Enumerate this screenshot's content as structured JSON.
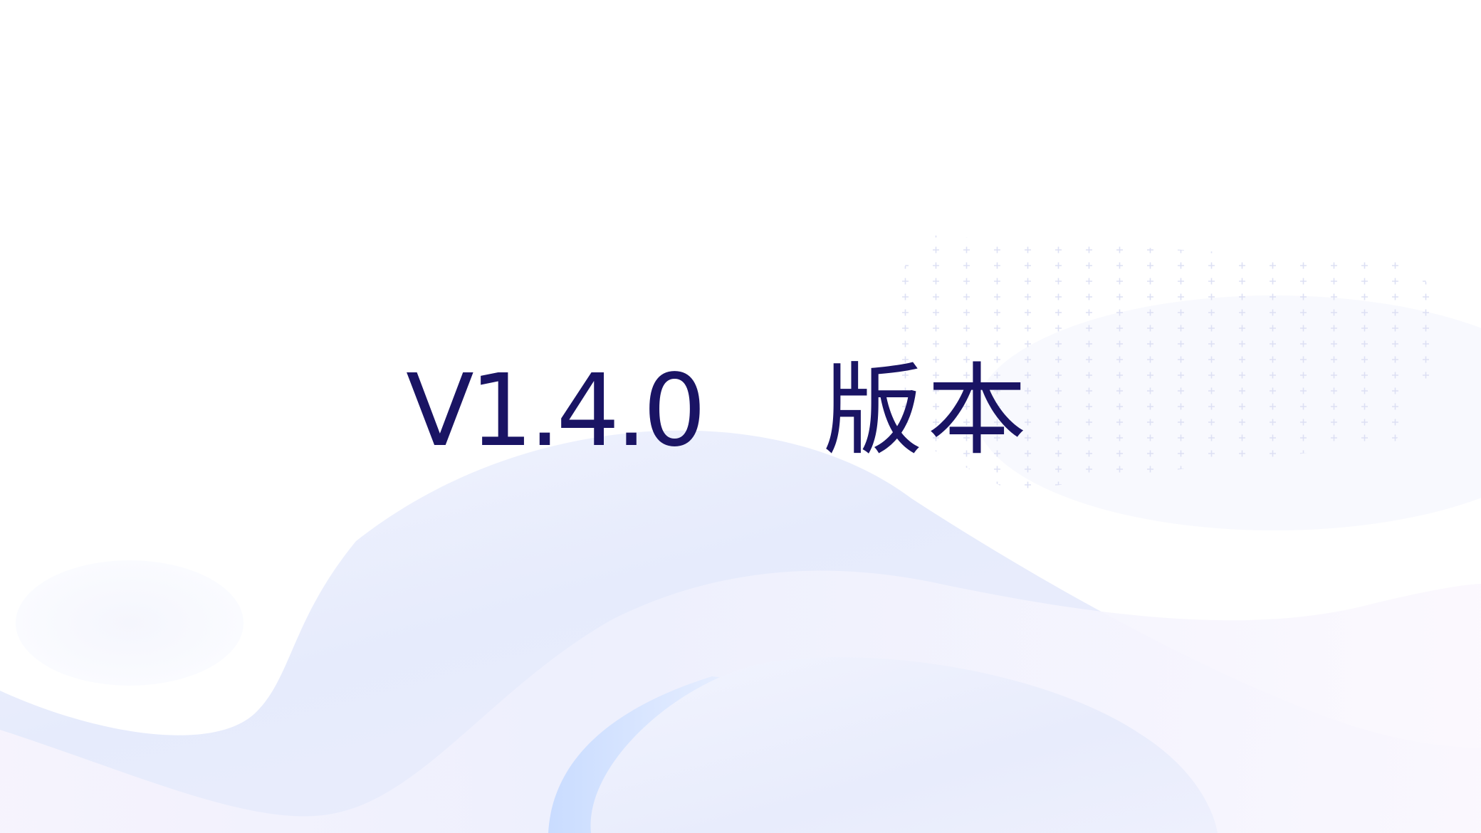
{
  "slide": {
    "version_number": "V1.4.0",
    "version_word": "版本"
  },
  "colors": {
    "title": "#1a1464",
    "wave_light": "#e6ebfc",
    "wave_blue": "#cfdeff",
    "wave_lavender": "#f6f3fc",
    "plus_pattern": "#dde0f4"
  },
  "decorations": {
    "pattern_icon": "plus-grid-pattern",
    "wave_icon": "abstract-wave-shapes"
  }
}
